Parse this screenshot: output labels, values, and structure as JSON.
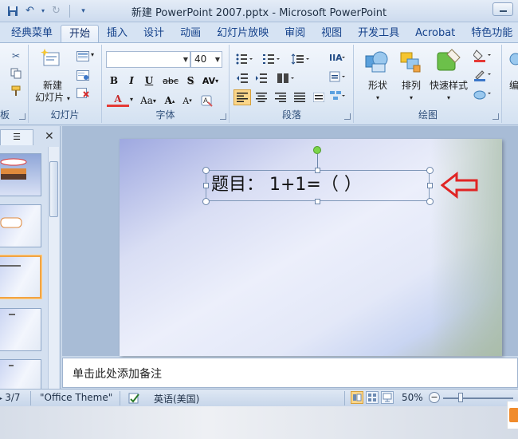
{
  "window": {
    "title": "新建 PowerPoint 2007.pptx - Microsoft PowerPoint"
  },
  "ribbon_tabs": [
    "经典菜单",
    "开始",
    "插入",
    "设计",
    "动画",
    "幻灯片放映",
    "审阅",
    "视图",
    "开发工具",
    "Acrobat",
    "特色功能"
  ],
  "active_tab": "开始",
  "groups": {
    "clipboard_label": "板",
    "slides_label": "幻灯片",
    "font_label": "字体",
    "paragraph_label": "段落",
    "drawing_label": "绘图"
  },
  "slides_group": {
    "new_slide_line1": "新建",
    "new_slide_line2": "幻灯片"
  },
  "font": {
    "name_value": "",
    "size_value": "40",
    "bold": "B",
    "italic": "I",
    "underline": "U",
    "strike": "abc",
    "shadow": "S",
    "spacing": "AV",
    "color_letter": "A",
    "case": "Aa",
    "grow": "A",
    "shrink": "A"
  },
  "drawing": {
    "shapes_label": "形状",
    "arrange_label": "排列",
    "quick_styles_label": "快速样式",
    "edit_label": "编"
  },
  "slide": {
    "textbox_text": "题目： 1+1=（    ）"
  },
  "notes": {
    "placeholder": "单击此处添加备注"
  },
  "status": {
    "slide_counter": "3/7",
    "theme": "\"Office Theme\"",
    "language": "英语(美国)",
    "zoom": "50%",
    "zoom_level": 0.5
  },
  "colors": {
    "accent_arrow": "#e02424",
    "selected_thumb": "#f0a445",
    "rotate_handle": "#7bd54a"
  }
}
